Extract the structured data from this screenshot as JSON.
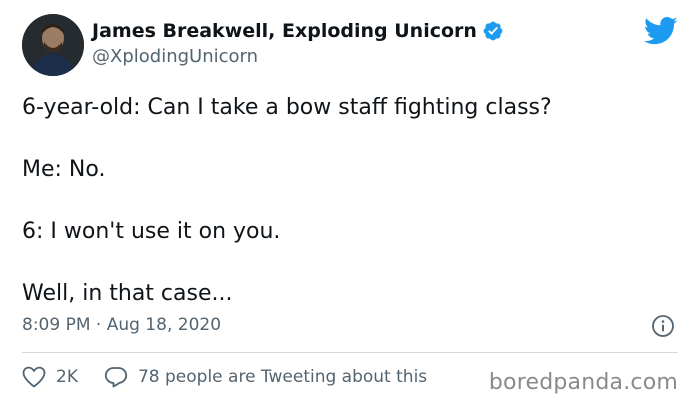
{
  "author": {
    "display_name": "James Breakwell, Exploding Unicorn",
    "handle": "@XplodingUnicorn",
    "verified": true
  },
  "tweet": {
    "lines": [
      "6-year-old: Can I take a bow staff fighting class?",
      "Me: No.",
      "6: I won't use it on you.",
      "Well, in that case..."
    ],
    "timestamp": "8:09 PM · Aug 18, 2020"
  },
  "engagement": {
    "likes": "2K",
    "conversation": "78 people are Tweeting about this"
  },
  "watermark": "boredpanda.com",
  "colors": {
    "twitter_blue": "#1d9bf0",
    "text": "#0f1419",
    "secondary": "#536471",
    "divider": "#cfd9de"
  },
  "icons": [
    "twitter-bird-icon",
    "verified-badge-icon",
    "info-icon",
    "heart-icon",
    "comment-icon"
  ]
}
